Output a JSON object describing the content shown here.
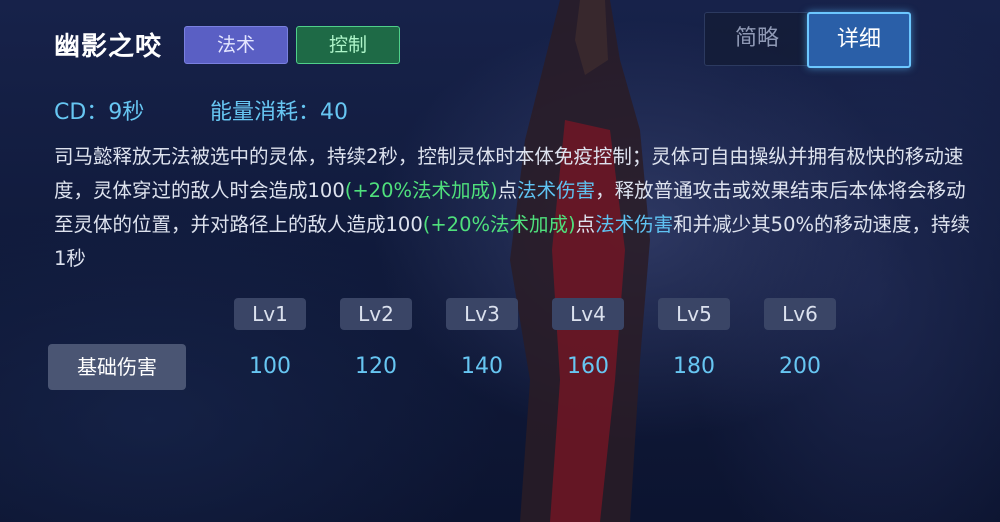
{
  "skill": {
    "name": "幽影之咬",
    "tags": [
      "法术",
      "控制"
    ]
  },
  "view_toggle": {
    "brief_label": "简略",
    "detail_label": "详细",
    "selected": "详细"
  },
  "stats": {
    "cd": "CD：9秒",
    "energy": "能量消耗：40"
  },
  "description": {
    "p1": "司马懿释放无法被选中的灵体，持续2秒，控制灵体时本体免疫控制；灵体可自由操纵并拥有极快的移动速度，灵体穿过的敌人时会造成100",
    "g1": "(+20%法术加成)",
    "p2": "点",
    "b1": "法术伤害",
    "p3": "，释放普通攻击或效果结束后本体将会移动至灵体的位置，并对路径上的敌人造成100",
    "g2": "(+20%法术加成)",
    "p4": "点",
    "b2": "法术伤害",
    "p5": "和并减少其50%的移动速度，持续1秒"
  },
  "levels": {
    "headers": [
      "Lv1",
      "Lv2",
      "Lv3",
      "Lv4",
      "Lv5",
      "Lv6"
    ],
    "row_label": "基础伤害",
    "values": [
      "100",
      "120",
      "140",
      "160",
      "180",
      "200"
    ]
  },
  "colors": {
    "accent_blue": "#67c6f2",
    "accent_green": "#4fe07c",
    "magic_tag": "#5a5fc4",
    "control_tag": "#1e6a46"
  }
}
